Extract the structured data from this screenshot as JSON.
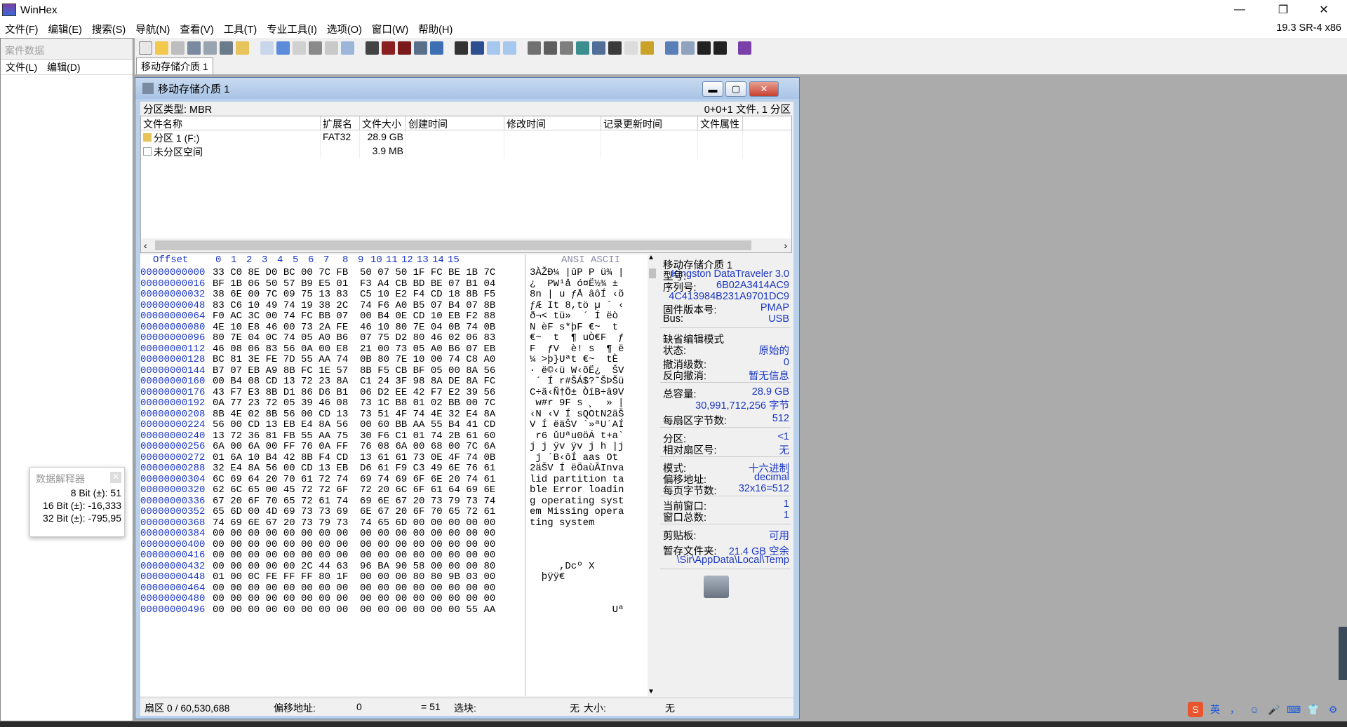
{
  "app": {
    "title": "WinHex",
    "version": "19.3 SR-4 x86"
  },
  "window_controls": {
    "minimize": "—",
    "restore": "❐",
    "close": "✕"
  },
  "menu": [
    "文件(F)",
    "编辑(E)",
    "搜索(S)",
    "导航(N)",
    "查看(V)",
    "工具(T)",
    "专业工具(I)",
    "选项(O)",
    "窗口(W)",
    "帮助(H)"
  ],
  "case_panel": {
    "header": "案件数据",
    "menu": [
      "文件(L)",
      "编辑(D)"
    ]
  },
  "tab": {
    "label": "移动存储介质 1"
  },
  "doc_window": {
    "title": "移动存储介质 1",
    "partition_type": "分区类型: MBR",
    "summary": "0+0+1 文件, 1 分区",
    "columns": [
      "文件名称",
      "扩展名",
      "文件大小",
      "创建时间",
      "修改时间",
      "记录更新时间",
      "文件属性"
    ],
    "rows": [
      {
        "name": "分区 1 (F:)",
        "ext": "FAT32",
        "size": "28.9 GB"
      },
      {
        "name": "未分区空间",
        "ext": "",
        "size": "3.9 MB"
      }
    ]
  },
  "hex": {
    "offset_label": "Offset",
    "col_labels": [
      "0",
      "1",
      "2",
      "3",
      "4",
      "5",
      "6",
      "7",
      "8",
      "9",
      "10",
      "11",
      "12",
      "13",
      "14",
      "15"
    ],
    "ascii_label": "ANSI ASCII",
    "rows": [
      {
        "off": "00000000000",
        "bytes": "33 C0 8E D0 BC 00 7C FB  50 07 50 1F FC BE 1B 7C",
        "ascii": "3ÀŽÐ¼ |ûP P ü¾ |"
      },
      {
        "off": "00000000016",
        "bytes": "BF 1B 06 50 57 B9 E5 01  F3 A4 CB BD BE 07 B1 04",
        "ascii": "¿  PW¹å ó¤Ë½¾ ±"
      },
      {
        "off": "00000000032",
        "bytes": "38 6E 00 7C 09 75 13 83  C5 10 E2 F4 CD 18 8B F5",
        "ascii": "8n | u ƒÅ âôÍ ‹õ"
      },
      {
        "off": "00000000048",
        "bytes": "83 C6 10 49 74 19 38 2C  74 F6 A0 B5 07 B4 07 8B",
        "ascii": "ƒÆ It 8,tö µ ´ ‹"
      },
      {
        "off": "00000000064",
        "bytes": "F0 AC 3C 00 74 FC BB 07  00 B4 0E CD 10 EB F2 88",
        "ascii": "ð¬< tü»  ´ Í ëò"
      },
      {
        "off": "00000000080",
        "bytes": "4E 10 E8 46 00 73 2A FE  46 10 80 7E 04 0B 74 0B",
        "ascii": "N èF s*þF €~  t "
      },
      {
        "off": "00000000096",
        "bytes": "80 7E 04 0C 74 05 A0 B6  07 75 D2 80 46 02 06 83",
        "ascii": "€~  t  ¶ uÒ€F  ƒ"
      },
      {
        "off": "00000000112",
        "bytes": "46 08 06 83 56 0A 00 E8  21 00 73 05 A0 B6 07 EB",
        "ascii": "F  ƒV  è! s  ¶ ë"
      },
      {
        "off": "00000000128",
        "bytes": "BC 81 3E FE 7D 55 AA 74  0B 80 7E 10 00 74 C8 A0",
        "ascii": "¼ >þ}Uªt €~  tÈ "
      },
      {
        "off": "00000000144",
        "bytes": "B7 07 EB A9 8B FC 1E 57  8B F5 CB BF 05 00 8A 56",
        "ascii": "· ë©‹ü W‹õË¿  ŠV"
      },
      {
        "off": "00000000160",
        "bytes": "00 B4 08 CD 13 72 23 8A  C1 24 3F 98 8A DE 8A FC",
        "ascii": " ´ Í r#ŠÁ$?˜ŠÞŠü"
      },
      {
        "off": "00000000176",
        "bytes": "43 F7 E3 8B D1 86 D6 B1  06 D2 EE 42 F7 E2 39 56",
        "ascii": "C÷ã‹Ñ†Ö± ÒîB÷â9V"
      },
      {
        "off": "00000000192",
        "bytes": "0A 77 23 72 05 39 46 08  73 1C B8 01 02 BB 00 7C",
        "ascii": " w#r 9F s ¸  » |"
      },
      {
        "off": "00000000208",
        "bytes": "8B 4E 02 8B 56 00 CD 13  73 51 4F 74 4E 32 E4 8A",
        "ascii": "‹N ‹V Í sQOtN2äŠ"
      },
      {
        "off": "00000000224",
        "bytes": "56 00 CD 13 EB E4 8A 56  00 60 BB AA 55 B4 41 CD",
        "ascii": "V Í ëäŠV `»ªU´AÍ"
      },
      {
        "off": "00000000240",
        "bytes": "13 72 36 81 FB 55 AA 75  30 F6 C1 01 74 2B 61 60",
        "ascii": " r6 ûUªu0öÁ t+a`"
      },
      {
        "off": "00000000256",
        "bytes": "6A 00 6A 00 FF 76 0A FF  76 08 6A 00 68 00 7C 6A",
        "ascii": "j j ÿv ÿv j h |j"
      },
      {
        "off": "00000000272",
        "bytes": "01 6A 10 B4 42 8B F4 CD  13 61 61 73 0E 4F 74 0B",
        "ascii": " j ´B‹ôÍ aas Ot "
      },
      {
        "off": "00000000288",
        "bytes": "32 E4 8A 56 00 CD 13 EB  D6 61 F9 C3 49 6E 76 61",
        "ascii": "2äŠV Í ëÖaùÃInva"
      },
      {
        "off": "00000000304",
        "bytes": "6C 69 64 20 70 61 72 74  69 74 69 6F 6E 20 74 61",
        "ascii": "lid partition ta"
      },
      {
        "off": "00000000320",
        "bytes": "62 6C 65 00 45 72 72 6F  72 20 6C 6F 61 64 69 6E",
        "ascii": "ble Error loadin"
      },
      {
        "off": "00000000336",
        "bytes": "67 20 6F 70 65 72 61 74  69 6E 67 20 73 79 73 74",
        "ascii": "g operating syst"
      },
      {
        "off": "00000000352",
        "bytes": "65 6D 00 4D 69 73 73 69  6E 67 20 6F 70 65 72 61",
        "ascii": "em Missing opera"
      },
      {
        "off": "00000000368",
        "bytes": "74 69 6E 67 20 73 79 73  74 65 6D 00 00 00 00 00",
        "ascii": "ting system"
      },
      {
        "off": "00000000384",
        "bytes": "00 00 00 00 00 00 00 00  00 00 00 00 00 00 00 00",
        "ascii": ""
      },
      {
        "off": "00000000400",
        "bytes": "00 00 00 00 00 00 00 00  00 00 00 00 00 00 00 00",
        "ascii": ""
      },
      {
        "off": "00000000416",
        "bytes": "00 00 00 00 00 00 00 00  00 00 00 00 00 00 00 00",
        "ascii": ""
      },
      {
        "off": "00000000432",
        "bytes": "00 00 00 00 00 2C 44 63  96 BA 90 58 00 00 00 80",
        "ascii": "     ,Dcº X   "
      },
      {
        "off": "00000000448",
        "bytes": "01 00 0C FE FF FF 80 1F  00 00 00 80 80 9B 03 00",
        "ascii": "  þÿÿ€      "
      },
      {
        "off": "00000000464",
        "bytes": "00 00 00 00 00 00 00 00  00 00 00 00 00 00 00 00",
        "ascii": ""
      },
      {
        "off": "00000000480",
        "bytes": "00 00 00 00 00 00 00 00  00 00 00 00 00 00 00 00",
        "ascii": ""
      },
      {
        "off": "00000000496",
        "bytes": "00 00 00 00 00 00 00 00  00 00 00 00 00 00 55 AA",
        "ascii": "              Uª"
      }
    ]
  },
  "info": {
    "name": "移动存储介质 1",
    "model_label": "型号:",
    "model": "Kingston DataTraveler 3.0",
    "serial_label": "序列号:",
    "serial1": "6B02A3414AC9",
    "serial2": "4C413984B231A9701DC9",
    "firmware_label": "固件版本号:",
    "firmware": "PMAP",
    "bus_label": "Bus:",
    "bus": "USB",
    "edit_mode": "缺省编辑模式",
    "state_label": "状态:",
    "state": "原始的",
    "undo_label": "撤消级数:",
    "undo": "0",
    "redo_label": "反向撤消:",
    "redo": "暂无信息",
    "capacity_label": "总容量:",
    "capacity": "28.9 GB",
    "capacity_bytes": "30,991,712,256 字节",
    "bps_label": "每扇区字节数:",
    "bps": "512",
    "partition_label": "分区:",
    "partition": "<1",
    "relsec_label": "相对扇区号:",
    "relsec": "无",
    "mode_label": "模式:",
    "mode": "十六进制",
    "offset_label": "偏移地址:",
    "offset": "decimal",
    "bpp_label": "每页字节数:",
    "bpp": "32x16=512",
    "curwin_label": "当前窗口:",
    "curwin": "1",
    "totwin_label": "窗口总数:",
    "totwin": "1",
    "clip_label": "剪贴板:",
    "clip": "可用",
    "temp_label": "暂存文件夹:",
    "temp": "21.4 GB 空余",
    "temp_path": "\\Sir\\AppData\\Local\\Temp"
  },
  "status": {
    "sector": "扇区 0 / 60,530,688",
    "offset_label": "偏移地址:",
    "offset": "0",
    "value": "= 51",
    "selection_label": "选块:",
    "selection": "无",
    "size_label": "大小:",
    "size": "无"
  },
  "interpreter": {
    "title": "数据解释器",
    "b8": "8 Bit (±): 51",
    "b16": "16 Bit (±): -16,333",
    "b32": "32 Bit (±): -795,95"
  },
  "tray": [
    "英",
    "，",
    "☺",
    "🎤",
    "⌨",
    "👕",
    "⚙"
  ]
}
